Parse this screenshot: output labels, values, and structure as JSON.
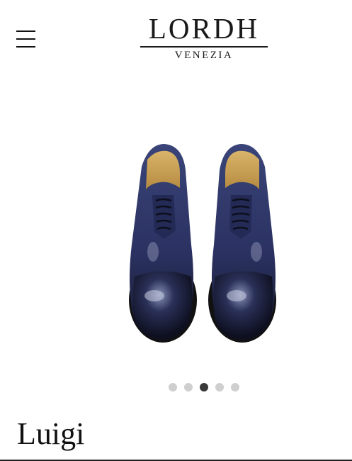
{
  "header": {
    "brand": "LORDH",
    "brand_sub": "VENEZIA",
    "menu_icon": "hamburger-menu-icon"
  },
  "gallery": {
    "image": "navy-blue-oxford-shoes",
    "dots_total": 5,
    "active_index": 2
  },
  "product": {
    "name": "Luigi"
  },
  "colors": {
    "text": "#111111",
    "dot_inactive": "#cfcfcf",
    "dot_active": "#3a3a3a",
    "shoe_leather": "#2a3160"
  }
}
